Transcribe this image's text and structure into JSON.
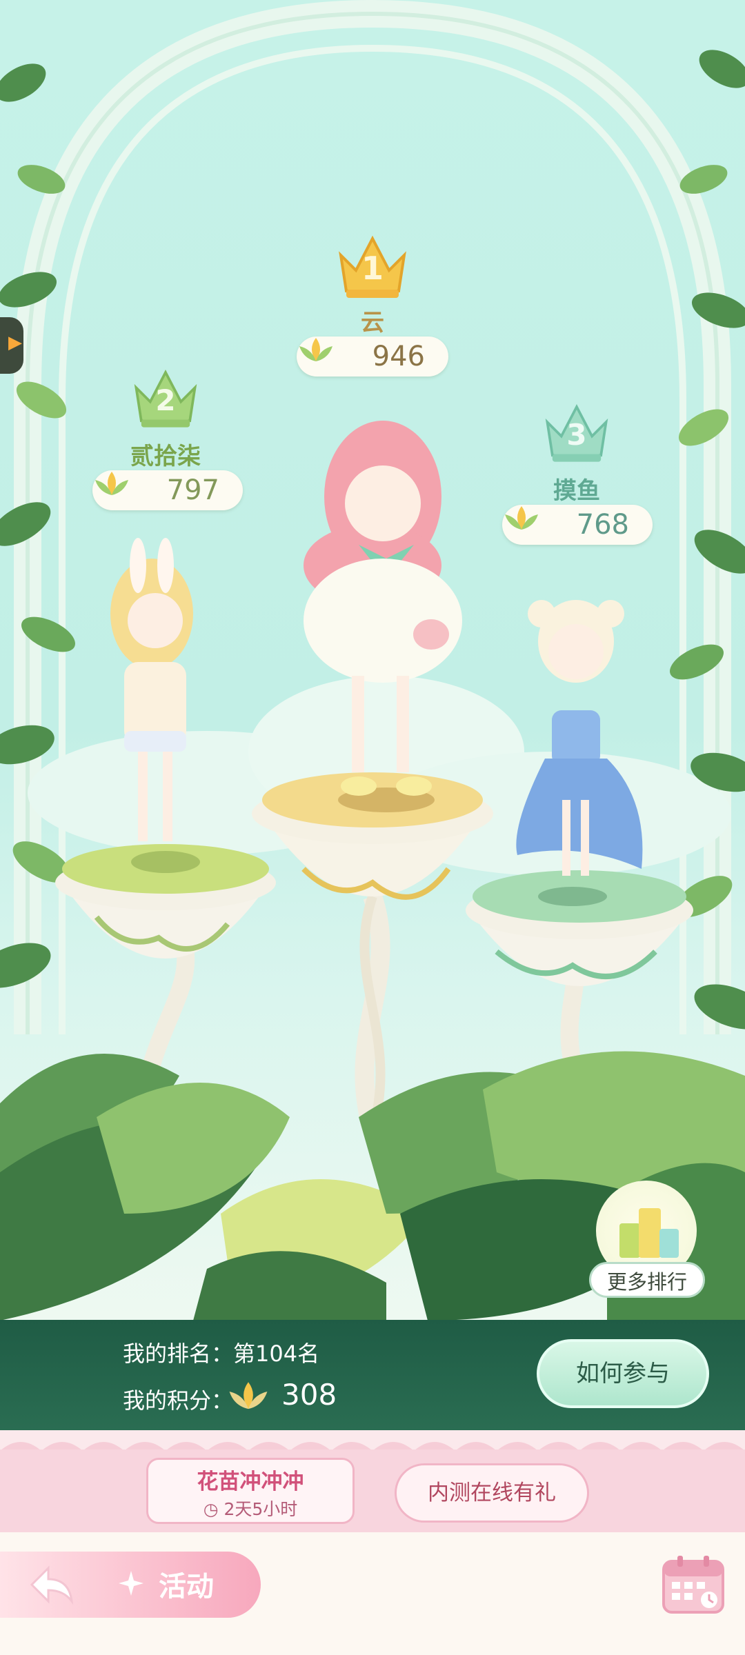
{
  "podium": {
    "first": {
      "rank": "1",
      "name": "云",
      "score": "946"
    },
    "second": {
      "rank": "2",
      "name": "贰拾柒",
      "score": "797"
    },
    "third": {
      "rank": "3",
      "name": "摸鱼",
      "score": "768"
    }
  },
  "more_ranking": {
    "label": "更多排行"
  },
  "my_status": {
    "rank_label": "我的排名：第104名",
    "points_label": "我的积分：",
    "points_value": "308"
  },
  "how_to_join": {
    "label": "如何参与"
  },
  "event_tabs": [
    {
      "label": "花苗冲冲冲",
      "countdown": "2天5小时",
      "selected": true
    },
    {
      "label": "内测在线有礼",
      "selected": false
    }
  ],
  "bottom_bar": {
    "activity_label": "活动"
  },
  "colors": {
    "sky": "#c6f2e8",
    "leaf_dark": "#3f7a44",
    "leaf_light": "#8fc26e",
    "rank_bar": "#235f48",
    "pink": "#f7a8bd",
    "gold": "#f2c24a"
  },
  "icons": [
    "crown-gold-icon",
    "crown-green-icon",
    "crown-teal-icon",
    "flower-point-icon",
    "arrow-back-icon",
    "sparkle-icon",
    "calendar-icon",
    "chart-icon",
    "clock-icon"
  ]
}
